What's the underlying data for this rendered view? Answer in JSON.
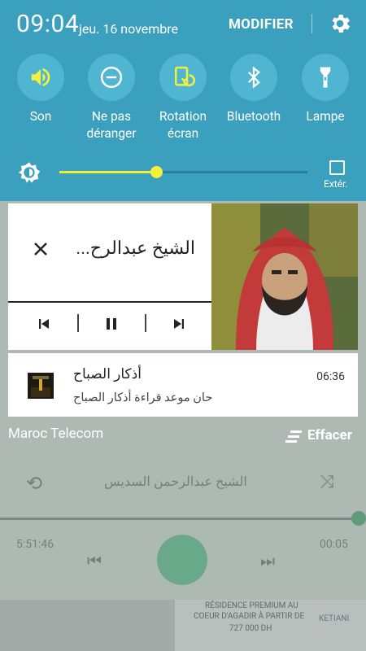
{
  "status": {
    "time": "09:04",
    "date": "jeu. 16 novembre"
  },
  "quick_settings": {
    "modify_label": "MODIFIER",
    "tiles": [
      {
        "label": "Son",
        "icon": "volume-icon",
        "active": true
      },
      {
        "label": "Ne pas\ndéranger",
        "icon": "do-not-disturb-icon",
        "active": false
      },
      {
        "label": "Rotation\nécran",
        "icon": "screen-rotation-icon",
        "active": true
      },
      {
        "label": "Bluetooth",
        "icon": "bluetooth-icon",
        "active": false
      },
      {
        "label": "Lampe",
        "icon": "flashlight-icon",
        "active": false
      }
    ],
    "brightness": {
      "level": 0.39,
      "extra_label": "Extér."
    }
  },
  "media_notification": {
    "title": "الشيخ عبدالرح...",
    "artist_full": "الشيخ عبدالرحمن السديس"
  },
  "app_notification": {
    "title": "أذكار الصباح",
    "body": "حان موعد قراءة أذكار الصباح",
    "time": "06:36"
  },
  "footer": {
    "carrier": "Maroc Telecom",
    "clear_label": "Effacer"
  },
  "background_player": {
    "artist": "الشيخ عبدالرحمن السديس",
    "elapsed": "5:51:46",
    "remaining": "00:05",
    "ad_line1": "RÉSIDENCE PREMIUM AU",
    "ad_line2": "COEUR D'AGADIR À PARTIR DE",
    "ad_price": "727 000 DH",
    "ad_brand": "KETIANI"
  },
  "colors": {
    "panel": "#3aa0bd",
    "tile": "#4fb5d0",
    "accent": "#f5f03c"
  }
}
